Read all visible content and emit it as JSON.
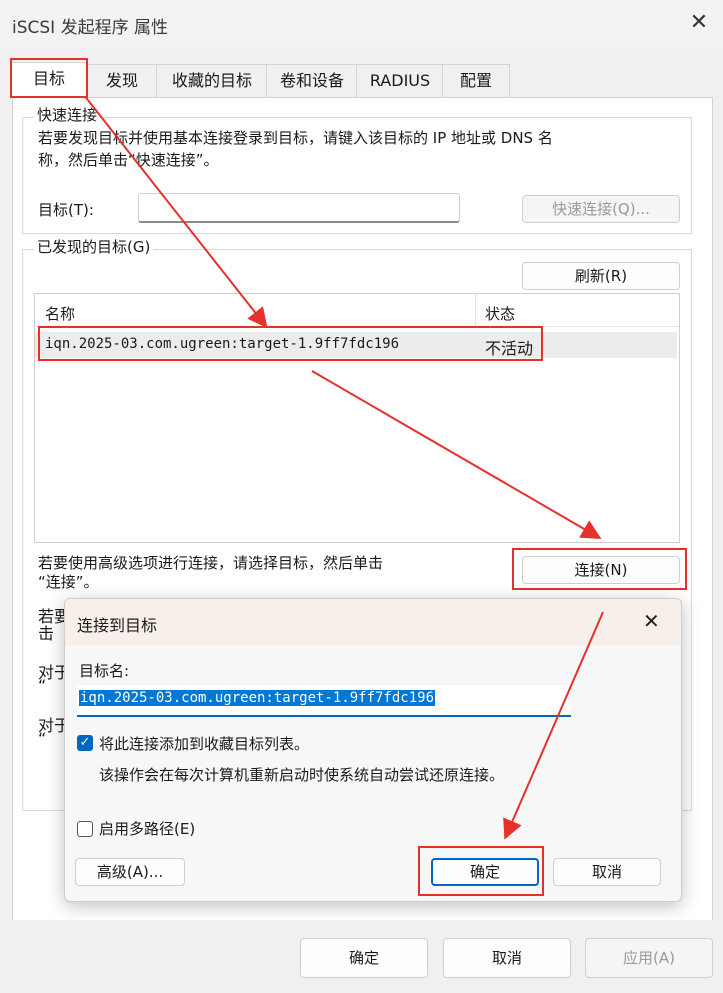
{
  "window": {
    "title": "iSCSI 发起程序 属性"
  },
  "tabs": [
    "目标",
    "发现",
    "收藏的目标",
    "卷和设备",
    "RADIUS",
    "配置"
  ],
  "quick_connect": {
    "legend": "快速连接",
    "desc_line1": "若要发现目标并使用基本连接登录到目标，请键入该目标的 IP 地址或 DNS 名",
    "desc_line2": "称，然后单击“快速连接”。",
    "target_label": "目标(T):",
    "target_value": "",
    "quick_connect_button": "快速连接(Q)..."
  },
  "discovered": {
    "legend": "已发现的目标(G)",
    "refresh_button": "刷新(R)",
    "columns": [
      "名称",
      "状态"
    ],
    "rows": [
      {
        "name": "iqn.2025-03.com.ugreen:target-1.9ff7fdc196",
        "status": "不活动"
      }
    ],
    "advanced_desc_line1": "若要使用高级选项进行连接，请选择目标，然后单击",
    "advanced_desc_line2": "“连接”。",
    "connect_button": "连接(N)",
    "hidden_frag1": "若要",
    "hidden_frag2": "击",
    "hidden_frag3": "对于",
    "hidden_frag4": "“",
    "hidden_frag5": "对于",
    "hidden_frag6": "“"
  },
  "dialog": {
    "title": "连接到目标",
    "target_name_label": "目标名:",
    "target_name_value": "iqn.2025-03.com.ugreen:target-1.9ff7fdc196",
    "add_favorite_label": "将此连接添加到收藏目标列表。",
    "add_favorite_checked": true,
    "add_favorite_note": "该操作会在每次计算机重新启动时使系统自动尝试还原连接。",
    "multipath_label": "启用多路径(E)",
    "multipath_checked": false,
    "advanced_button": "高级(A)...",
    "ok_button": "确定",
    "cancel_button": "取消"
  },
  "footer": {
    "ok": "确定",
    "cancel": "取消",
    "apply": "应用(A)"
  },
  "colors": {
    "accent": "#0067c0",
    "annotation_red": "#e5312c",
    "selection": "#0078d4"
  }
}
